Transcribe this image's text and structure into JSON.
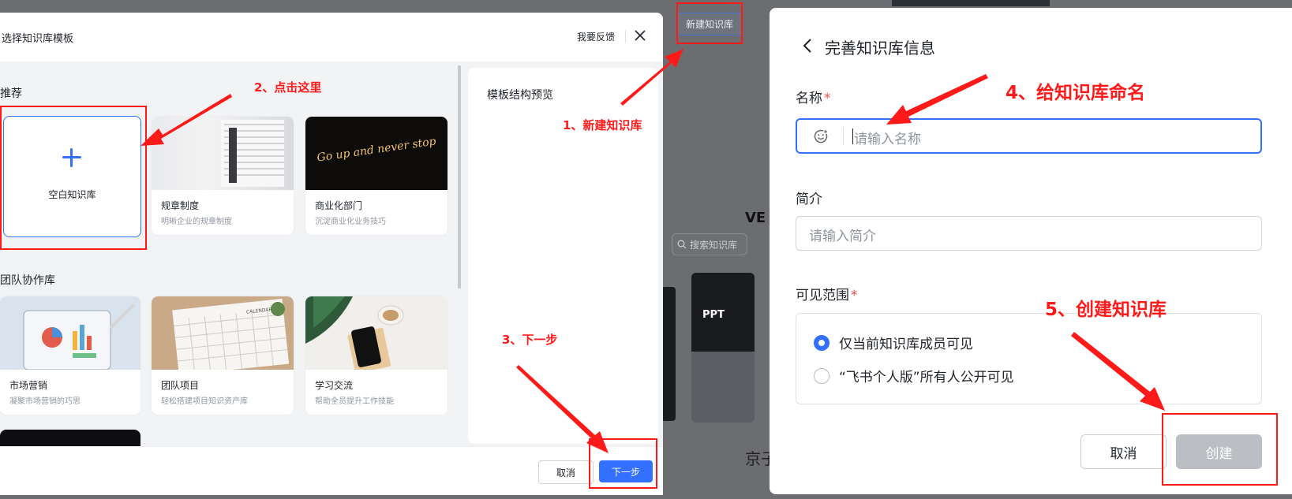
{
  "background": {
    "new_kb_button": "新建知识库",
    "search_placeholder": "搜索知识库",
    "card_label": "PPT",
    "partial_text_1": "VE",
    "partial_text_2": "京子"
  },
  "left_modal": {
    "title": "选择知识库模板",
    "feedback": "我要反馈",
    "sections": {
      "recommended": "推荐",
      "team": "团队协作库"
    },
    "blank_card": {
      "label": "空白知识库"
    },
    "recommended_cards": [
      {
        "name": "规章制度",
        "desc": "明晰企业的规章制度"
      },
      {
        "name": "商业化部门",
        "desc": "沉淀商业化业务技巧",
        "image_text": "Go up and never stop"
      }
    ],
    "team_cards": [
      {
        "name": "市场营销",
        "desc": "凝聚市场营销的巧思"
      },
      {
        "name": "团队项目",
        "desc": "轻松搭建项目知识资产库",
        "image_text": "CALENDAR"
      },
      {
        "name": "学习交流",
        "desc": "帮助全员提升工作技能"
      }
    ],
    "preview_title": "模板结构预览",
    "cancel_button": "取消",
    "next_button": "下一步"
  },
  "right_modal": {
    "title": "完善知识库信息",
    "name_label": "名称",
    "required_mark": "*",
    "name_placeholder": "请输入名称",
    "intro_label": "简介",
    "intro_placeholder": "请输入简介",
    "visibility_label": "可见范围",
    "visibility_options": [
      {
        "label": "仅当前知识库成员可见",
        "selected": true
      },
      {
        "label": "“飞书个人版”所有人公开可见",
        "selected": false
      }
    ],
    "cancel_button": "取消",
    "create_button": "创建"
  },
  "annotations": {
    "step1": "1、新建知识库",
    "step2": "2、点击这里",
    "step3": "3、下一步",
    "step4": "4、给知识库命名",
    "step5": "5、创建知识库",
    "color": "#ff1a1a"
  },
  "colors": {
    "accent": "#3370ff",
    "disabled_button": "#bbbfc4",
    "overlay": "#6b6d70",
    "required": "#f54a45"
  }
}
